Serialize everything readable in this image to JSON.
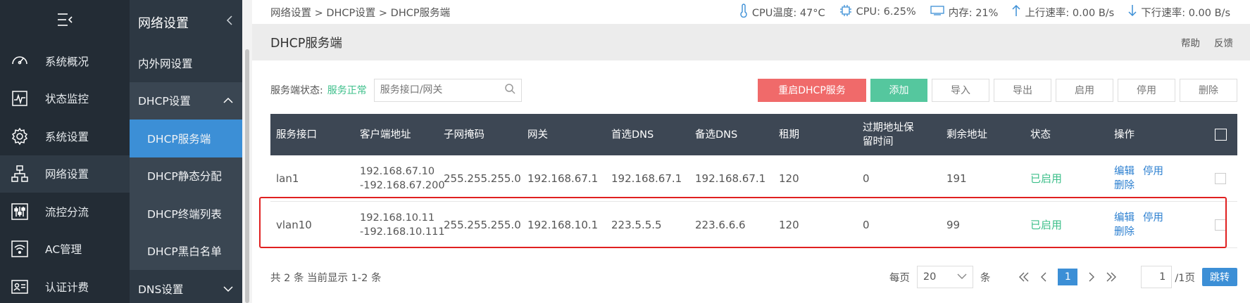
{
  "nav1": {
    "items": [
      {
        "label": "系统概况",
        "icon": "dashboard-icon"
      },
      {
        "label": "状态监控",
        "icon": "monitor-icon"
      },
      {
        "label": "系统设置",
        "icon": "gear-icon"
      },
      {
        "label": "网络设置",
        "icon": "network-icon"
      },
      {
        "label": "流控分流",
        "icon": "sliders-icon"
      },
      {
        "label": "AC管理",
        "icon": "wifi-icon"
      },
      {
        "label": "认证计费",
        "icon": "id-card-icon"
      }
    ]
  },
  "nav2": {
    "title": "网络设置",
    "items": [
      "内外网设置",
      "DHCP设置",
      "DHCP服务端",
      "DHCP静态分配",
      "DHCP终端列表",
      "DHCP黑白名单",
      "DNS设置"
    ]
  },
  "topbar": {
    "breadcrumb": "网络设置 > DHCP设置 > DHCP服务端",
    "cpu_temp": "CPU温度: 47°C",
    "cpu": "CPU: 6.25%",
    "mem": "内存: 21%",
    "up": "上行速率: 0.00 B/s",
    "down": "下行速率: 0.00 B/s"
  },
  "header": {
    "title": "DHCP服务端",
    "help": "帮助",
    "feedback": "反馈"
  },
  "toolbar": {
    "status_label": "服务端状态:",
    "status_value": "服务正常",
    "search_placeholder": "服务接口/网关",
    "restart": "重启DHCP服务",
    "add": "添加",
    "import": "导入",
    "export": "导出",
    "enable": "启用",
    "disable": "停用",
    "delete": "删除"
  },
  "table": {
    "headers": [
      "服务接口",
      "客户端地址",
      "子网掩码",
      "网关",
      "首选DNS",
      "备选DNS",
      "租期",
      "过期地址保留时间",
      "剩余地址",
      "状态",
      "操作"
    ],
    "rows": [
      {
        "iface": "lan1",
        "addr1": "192.168.67.10",
        "addr2": "-192.168.67.200",
        "mask": "255.255.255.0",
        "gw": "192.168.67.1",
        "dns1": "192.168.67.1",
        "dns2": "192.168.67.1",
        "lease": "120",
        "retain": "0",
        "remain": "191",
        "status": "已启用",
        "edit": "编辑",
        "disable": "停用",
        "delete": "删除"
      },
      {
        "iface": "vlan10",
        "addr1": "192.168.10.11",
        "addr2": "-192.168.10.111",
        "mask": "255.255.255.0",
        "gw": "192.168.10.1",
        "dns1": "223.5.5.5",
        "dns2": "223.6.6.6",
        "lease": "120",
        "retain": "0",
        "remain": "99",
        "status": "已启用",
        "edit": "编辑",
        "disable": "停用",
        "delete": "删除"
      }
    ]
  },
  "pager": {
    "summary": "共 2 条 当前显示 1-2 条",
    "per_page_label": "每页",
    "per_page": "20",
    "unit": "条",
    "current": "1",
    "page_input": "1",
    "total_pages": "/1页",
    "jump": "跳转"
  },
  "colors": {
    "accent": "#3c8fd6",
    "danger": "#f06a6a",
    "success": "#55c79e",
    "sidebar": "#232c35"
  }
}
